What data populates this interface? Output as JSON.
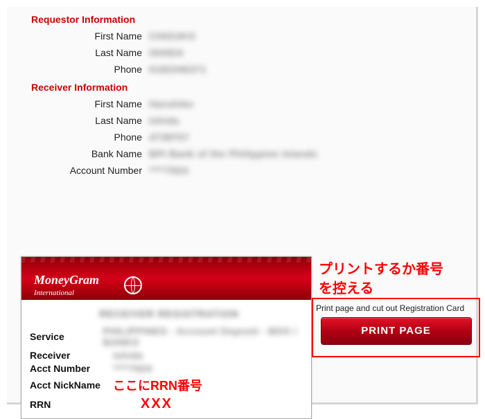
{
  "requestor": {
    "title": "Requestor Information",
    "first_name_label": "First Name",
    "first_name": "CHIZUKO",
    "last_name_label": "Last Name",
    "last_name": "ISHIDA",
    "phone_label": "Phone",
    "phone": "0182346371"
  },
  "receiver": {
    "title": "Receiver Information",
    "first_name_label": "First Name",
    "first_name": "Haruhiko",
    "last_name_label": "Last Name",
    "last_name": "Ishida",
    "phone_label": "Phone",
    "phone": "4738757",
    "bank_label": "Bank Name",
    "bank": "BPI Bank of the Philippine Islands",
    "acct_label": "Account Number",
    "acct": "****7924"
  },
  "card": {
    "brand_main": "MoneyGram",
    "brand_sub": "International",
    "heading": "RECEIVER REGISTRATION",
    "service_label": "Service",
    "service_value": "PHILIPPINES - Account Deposit - BDO / BANKS",
    "receiver_label": "Receiver",
    "receiver_value": "Ishida",
    "acct_label": "Acct Number",
    "acct_value": "****7924",
    "nick_label": "Acct NickName",
    "rrn_label": "RRN"
  },
  "annotations": {
    "line1": "プリントするか番号",
    "line2": "を控える",
    "rrn_here": "ここにRRN番号",
    "rrn_x": "XXX"
  },
  "print": {
    "caption": "Print page and cut out Registration Card",
    "button": "PRINT PAGE"
  }
}
